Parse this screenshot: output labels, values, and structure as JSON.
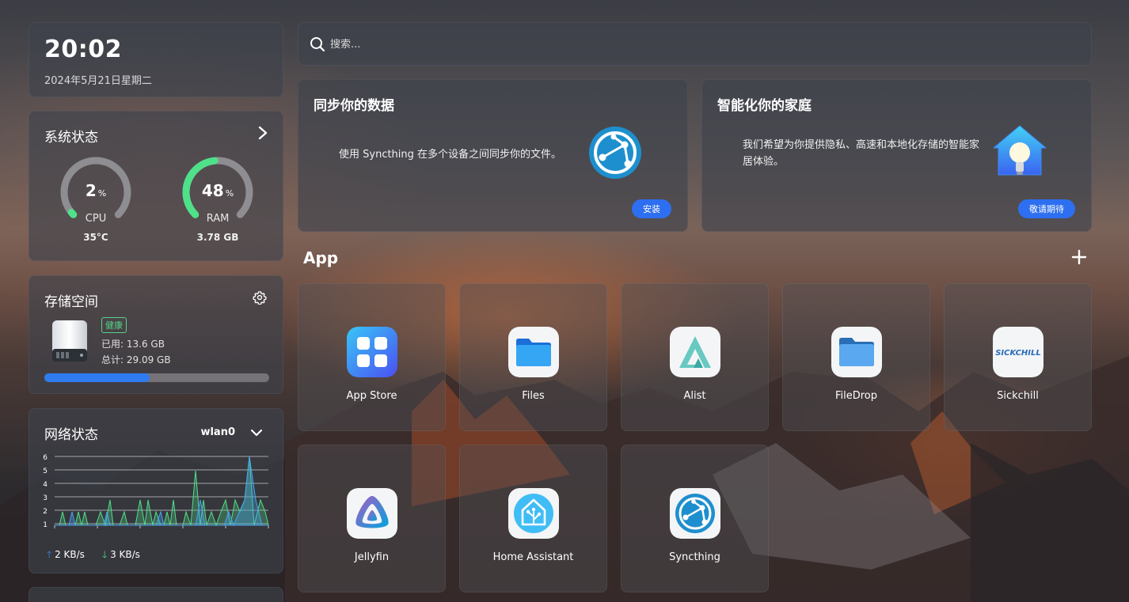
{
  "clock": {
    "time": "20:02",
    "date": "2024年5月21日星期二"
  },
  "system": {
    "title": "系统状态",
    "cpu": {
      "percent": 2,
      "unit": "%",
      "label": "CPU",
      "temp": "35°C"
    },
    "ram": {
      "percent": 48,
      "unit": "%",
      "label": "RAM",
      "used": "3.78 GB"
    }
  },
  "storage": {
    "title": "存储空间",
    "health": "健康",
    "used": "已用: 13.6 GB",
    "total": "总计: 29.09 GB",
    "used_fraction": 0.468
  },
  "network": {
    "title": "网络状态",
    "interface": "wlan0",
    "upload": "2 KB/s",
    "download": "3 KB/s",
    "y_ticks": [
      "6",
      "5",
      "4",
      "3",
      "2",
      "1"
    ]
  },
  "search": {
    "placeholder": "搜索..."
  },
  "promos": {
    "sync": {
      "title": "同步你的数据",
      "desc": "使用 Syncthing 在多个设备之间同步你的文件。",
      "button": "安装"
    },
    "home": {
      "title": "智能化你的家庭",
      "desc": "我们希望为你提供隐私、高速和本地化存储的智能家居体验。",
      "button": "敬请期待"
    }
  },
  "apps": {
    "heading": "App",
    "items": [
      {
        "name": "App Store",
        "icon": "app-store-icon"
      },
      {
        "name": "Files",
        "icon": "files-icon"
      },
      {
        "name": "Alist",
        "icon": "alist-icon"
      },
      {
        "name": "FileDrop",
        "icon": "filedrop-icon"
      },
      {
        "name": "Sickchill",
        "icon": "sickchill-icon",
        "logo_text": "SICKCHILL"
      },
      {
        "name": "Jellyfin",
        "icon": "jellyfin-icon"
      },
      {
        "name": "Home Assistant",
        "icon": "home-assistant-icon"
      },
      {
        "name": "Syncthing",
        "icon": "syncthing-icon"
      }
    ]
  },
  "colors": {
    "accent": "#2d6ff0",
    "gauge_green": "#4fe08a",
    "health_green": "#57d38c",
    "storage_bar": "#2f7bf0"
  }
}
